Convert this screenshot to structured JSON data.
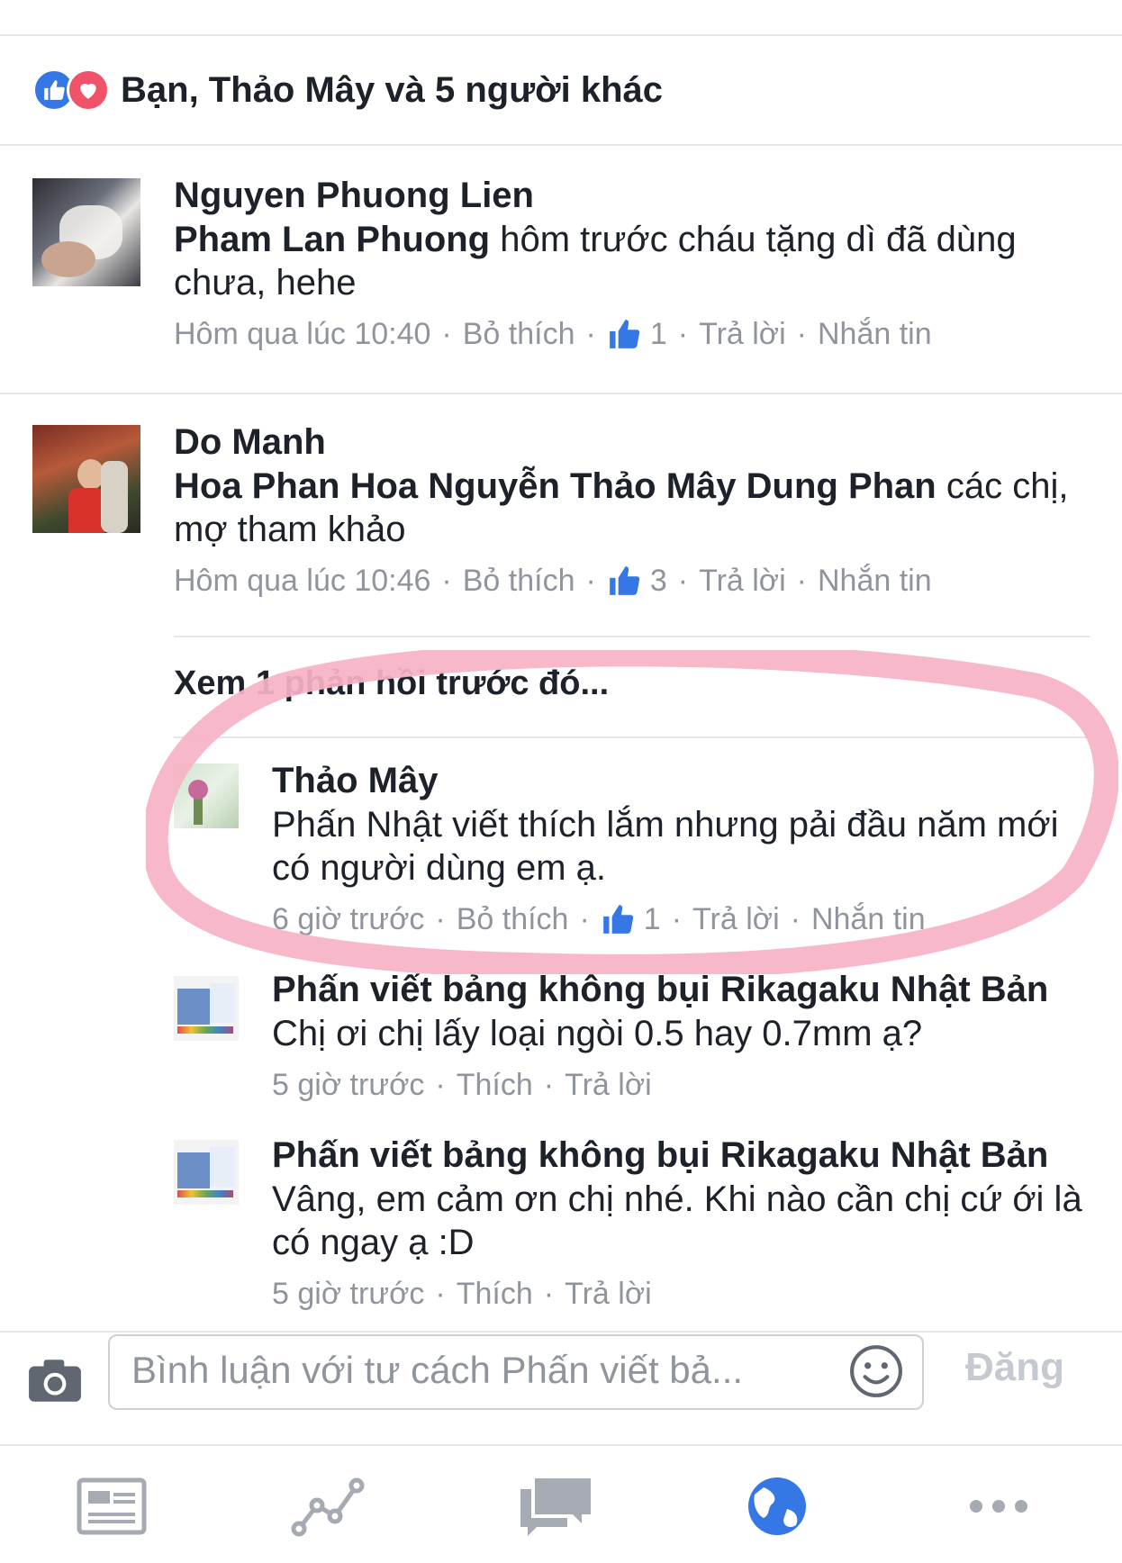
{
  "reactions": {
    "text": "Bạn, Thảo Mây và 5 người khác"
  },
  "comments": [
    {
      "author": "Nguyen Phuong Lien",
      "mention": "Pham Lan Phuong",
      "text": " hôm trước cháu tặng dì đã dùng chưa, hehe",
      "time": "Hôm qua lúc 10:40",
      "unlike": "Bỏ thích",
      "likes": "1",
      "reply": "Trả lời",
      "message": "Nhắn tin"
    },
    {
      "author": "Do Manh",
      "mention": "Hoa Phan Hoa Nguyễn  Thảo Mây Dung Phan",
      "text": "  các chị, mợ tham khảo",
      "time": "Hôm qua lúc 10:46",
      "unlike": "Bỏ thích",
      "likes": "3",
      "reply": "Trả lời",
      "message": "Nhắn tin"
    }
  ],
  "see_previous": "Xem 1 phản hồi trước đó...",
  "replies": [
    {
      "author": "Thảo Mây",
      "text": "Phấn Nhật viết thích lắm nhưng pải đầu năm mới có người dùng em ạ.",
      "time": "6 giờ trước",
      "unlike": "Bỏ thích",
      "likes": "1",
      "reply": "Trả lời",
      "message": "Nhắn tin"
    },
    {
      "author": "Phấn viết bảng không bụi Rikagaku Nhật Bản",
      "text": "Chị ơi chị lấy loại ngòi 0.5 hay 0.7mm ạ?",
      "time": "5 giờ trước",
      "like": "Thích",
      "reply": "Trả lời"
    },
    {
      "author": "Phấn viết bảng không bụi Rikagaku Nhật Bản",
      "text": "Vâng, em cảm ơn chị nhé. Khi nào cần chị cứ ới là có ngay ạ :D",
      "time": "5 giờ trước",
      "like": "Thích",
      "reply": "Trả lời"
    }
  ],
  "composer": {
    "placeholder": "Bình luận với tư cách Phấn viết bả...",
    "post": "Đăng"
  },
  "tabs": [
    "news-feed-icon",
    "insights-icon",
    "messages-icon",
    "notifications-globe-icon",
    "more-icon"
  ],
  "colors": {
    "accent": "#3578e5",
    "love": "#f0526a",
    "highlight": "#f7b6c8",
    "meta": "#90949c"
  }
}
